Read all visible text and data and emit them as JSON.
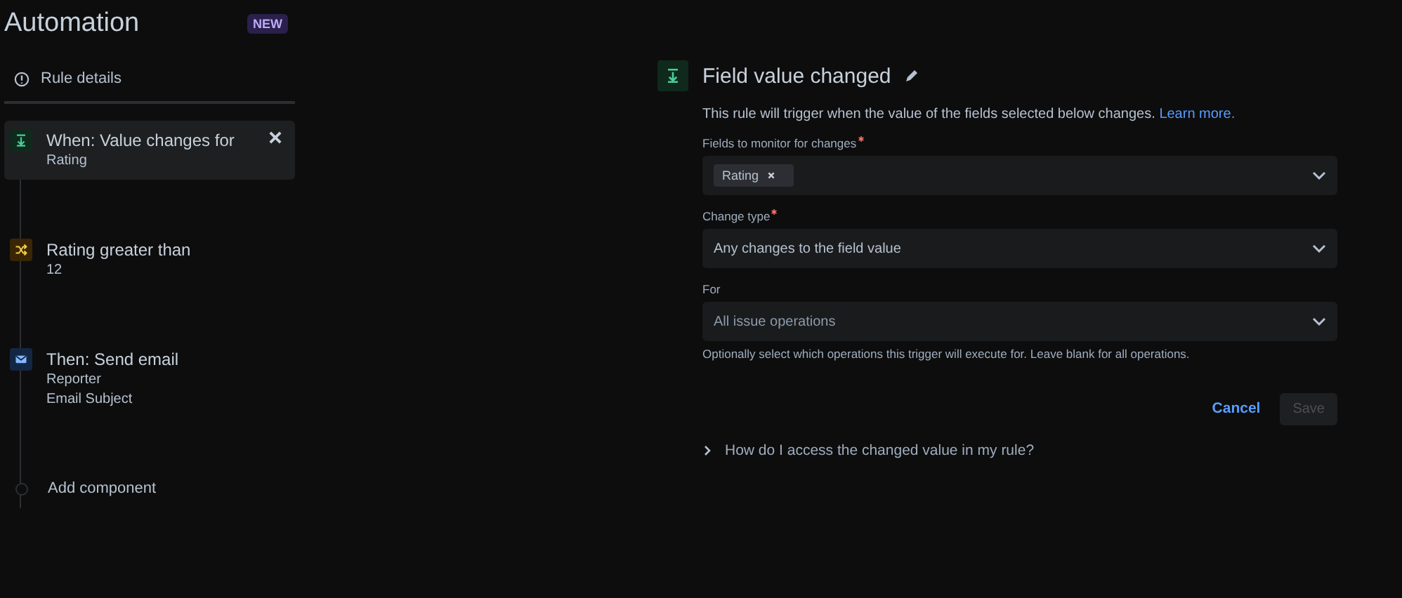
{
  "sidebar": {
    "title": "Automation",
    "badge": "NEW",
    "rule_details": "Rule details",
    "components": [
      {
        "kind": "trigger",
        "title": "When: Value changes for",
        "lines": [
          "Rating"
        ],
        "selected": true,
        "removable": true
      },
      {
        "kind": "condition",
        "title": "Rating greater than",
        "lines": [
          "12"
        ],
        "selected": false,
        "removable": false
      },
      {
        "kind": "action",
        "title": "Then: Send email",
        "lines": [
          "Reporter",
          "Email Subject"
        ],
        "selected": false,
        "removable": false
      }
    ],
    "add_component": "Add component"
  },
  "panel": {
    "title": "Field value changed",
    "description": "This rule will trigger when the value of the fields selected below changes.",
    "link": "Learn more.",
    "fields": [
      {
        "label": "Fields to monitor for changes",
        "required": true,
        "tags": [
          "Rating"
        ]
      },
      {
        "label": "Change type",
        "required": true,
        "value": "Any changes to the field value"
      },
      {
        "label": "For",
        "required": false,
        "placeholder": "All issue operations",
        "help": "Optionally select which operations this trigger will execute for. Leave blank for all operations."
      }
    ],
    "cancel": "Cancel",
    "save": {
      "label": "Save",
      "disabled": true
    },
    "expander": {
      "label": "How do I access the changed value in my rule?",
      "expanded": false
    }
  }
}
